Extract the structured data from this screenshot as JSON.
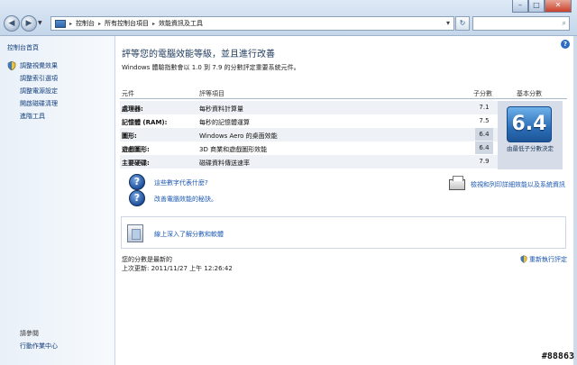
{
  "address": {
    "crumbs": [
      "控制台",
      "所有控制台項目",
      "效能資訊及工具"
    ],
    "search_placeholder": "搜尋控制台"
  },
  "sidebar": {
    "home": "控制台首頁",
    "items": [
      "調整視覺效果",
      "調整索引選項",
      "調整電源設定",
      "開啟磁碟清理",
      "進階工具"
    ],
    "see_also_heading": "請參閱",
    "see_also": [
      "行動作業中心"
    ]
  },
  "main": {
    "heading": "評等您的電腦效能等級，並且進行改善",
    "description": "Windows 體驗指數會以 1.0 到 7.9 的分數評定重要系統元件。",
    "columns": {
      "component": "元件",
      "rated": "評等項目",
      "subscore": "子分數",
      "base": "基本分數"
    },
    "rows": [
      {
        "name": "處理器:",
        "desc": "每秒資料計算量",
        "score": "7.1"
      },
      {
        "name": "記憶體 (RAM):",
        "desc": "每秒的記憶體運算",
        "score": "7.5"
      },
      {
        "name": "圖形:",
        "desc": "Windows Aero 的桌面效能",
        "score": "6.4"
      },
      {
        "name": "遊戲圖形:",
        "desc": "3D 商業和遊戲圖形效能",
        "score": "6.4"
      },
      {
        "name": "主要硬碟:",
        "desc": "磁碟資料傳送速率",
        "score": "7.9"
      }
    ],
    "base_score": "6.4",
    "base_caption": "由最低子分數決定",
    "links": {
      "what_mean": "這些數字代表什麼?",
      "tips": "改善電腦效能的秘訣。",
      "print": "檢視和列印詳細效能以及系統資訊",
      "learn_more": "線上深入了解分數和軟體"
    },
    "status": {
      "line1": "您的分數是最新的",
      "line2": "上次更新: 2011/11/27 上午 12:26:42"
    },
    "rerun": "重新執行評定"
  },
  "watermark": "#88863"
}
